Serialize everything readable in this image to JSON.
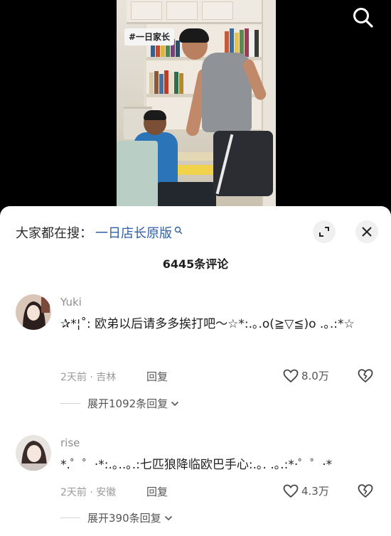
{
  "video": {
    "hashtag": "#一日家长"
  },
  "sheet": {
    "search_prefix": "大家都在搜：",
    "search_term": "一日店长原版",
    "comment_count_label": "6445条评论"
  },
  "comments": [
    {
      "username": "Yuki",
      "text": "✰*¦˚: 欧弟以后请多多挨打吧～☆*:.｡.o(≧▽≦)o .｡.:*☆",
      "time": "2天前",
      "location": "吉林",
      "reply_label": "回复",
      "likes": "8.0万",
      "replies_label": "展开1092条回复"
    },
    {
      "username": "rise",
      "text": "*.゜゜·*:.｡..｡.:七匹狼降临欧巴手心:.｡. .｡.:*·゜゜·*",
      "time": "2天前",
      "location": "安徽",
      "reply_label": "回复",
      "likes": "4.3万",
      "replies_label": "展开390条回复"
    }
  ],
  "icons": {
    "search": "search-icon",
    "expand": "expand-icon",
    "close": "close-icon",
    "like": "heart-icon",
    "dislike": "broken-heart-icon",
    "chevron": "chevron-down-icon"
  },
  "colors": {
    "link_blue": "#2f5fa8",
    "meta_gray": "#9a9a9a"
  }
}
